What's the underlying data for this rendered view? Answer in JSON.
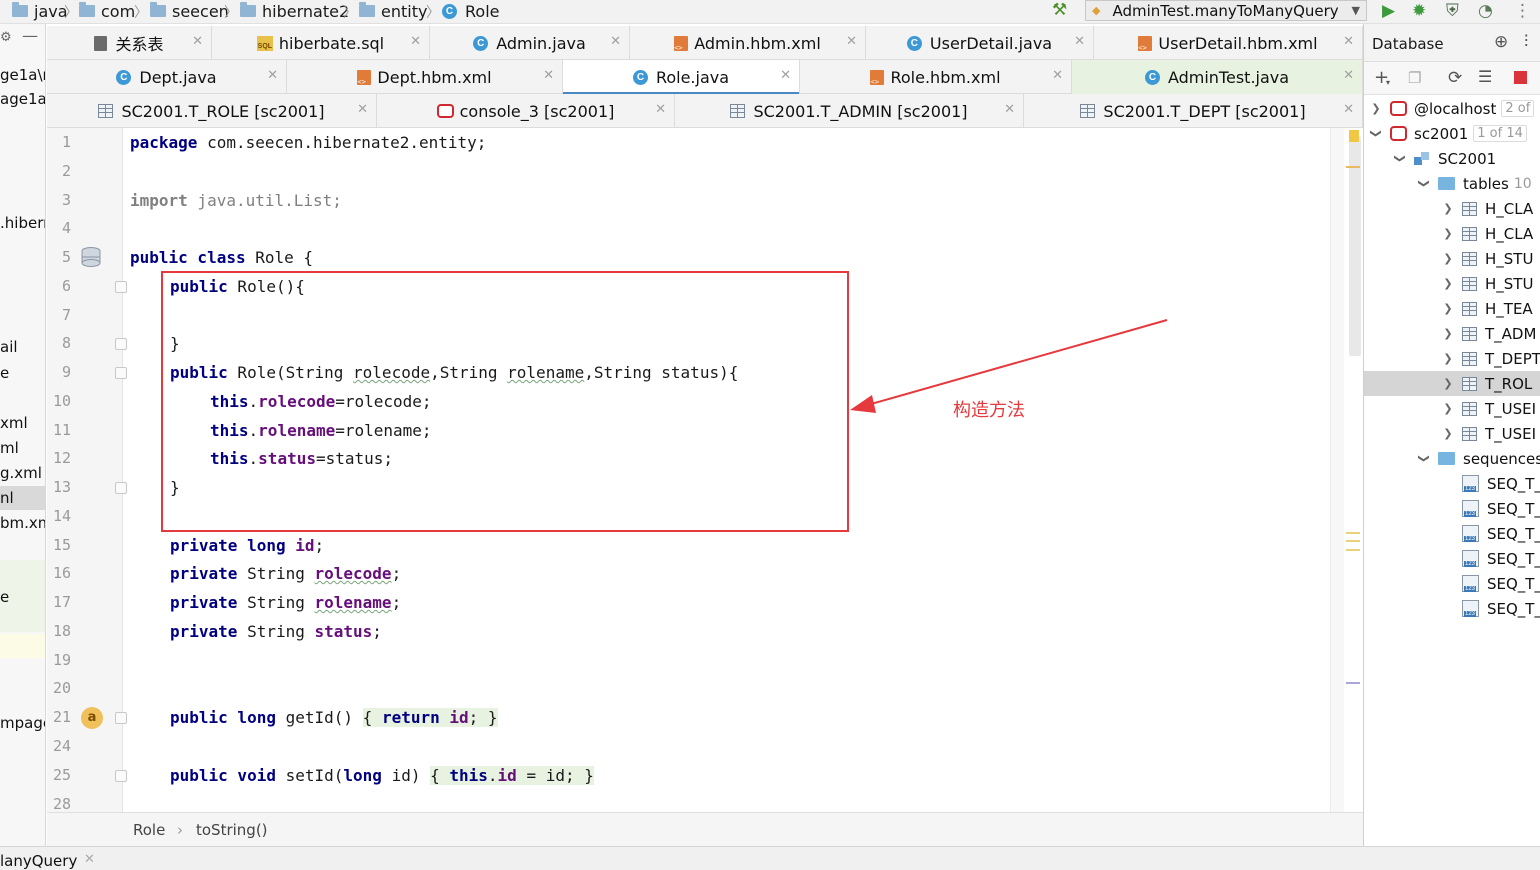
{
  "navbar": {
    "crumbs": [
      "java",
      "com",
      "seecen",
      "hibernate2",
      "entity",
      "Role"
    ],
    "run_config": "AdminTest.manyToManyQuery"
  },
  "left_panel": {
    "fragments": [
      "ge1a\\n",
      "age1a\\",
      ".hiberr",
      "ail",
      "e",
      "xml",
      "ml",
      "g.xml",
      "nl",
      "bm.xm",
      "e",
      "mpage"
    ]
  },
  "tabs": {
    "row1": [
      {
        "label": "关系表",
        "icon": "table-relation-icon"
      },
      {
        "label": "hiberbate.sql",
        "icon": "sql-file-icon"
      },
      {
        "label": "Admin.java",
        "icon": "java-class-icon"
      },
      {
        "label": "Admin.hbm.xml",
        "icon": "xml-file-icon"
      },
      {
        "label": "UserDetail.java",
        "icon": "java-class-icon"
      },
      {
        "label": "UserDetail.hbm.xml",
        "icon": "xml-file-icon"
      }
    ],
    "row2": [
      {
        "label": "Dept.java",
        "icon": "java-class-icon"
      },
      {
        "label": "Dept.hbm.xml",
        "icon": "xml-file-icon"
      },
      {
        "label": "Role.java",
        "icon": "java-class-icon",
        "active": true
      },
      {
        "label": "Role.hbm.xml",
        "icon": "xml-file-icon"
      },
      {
        "label": "AdminTest.java",
        "icon": "java-test-class-icon"
      }
    ],
    "row3": [
      {
        "label": "SC2001.T_ROLE [sc2001]",
        "icon": "table-icon"
      },
      {
        "label": "console_3 [sc2001]",
        "icon": "console-icon"
      },
      {
        "label": "SC2001.T_ADMIN [sc2001]",
        "icon": "table-icon"
      },
      {
        "label": "SC2001.T_DEPT [sc2001]",
        "icon": "table-icon"
      }
    ]
  },
  "editor": {
    "line_numbers": [
      "1",
      "2",
      "3",
      "4",
      "5",
      "6",
      "7",
      "8",
      "9",
      "10",
      "11",
      "12",
      "13",
      "14",
      "15",
      "16",
      "17",
      "18",
      "19",
      "20",
      "21",
      "24",
      "25",
      "28"
    ],
    "code": {
      "l1_kw": "package",
      "l1_rest": " com.seecen.hibernate2.entity;",
      "l3_kw": "import",
      "l3_rest": " java.util.List;",
      "l5_kw": "public class",
      "l5_rest": " Role {",
      "l6_kw": "public",
      "l6_rest": " Role(){",
      "l8": "}",
      "l9_kw": "public",
      "l9_a": " Role(String ",
      "l9_p1": "rolecode",
      "l9_b": ",String ",
      "l9_p2": "rolename",
      "l9_c": ",String status){",
      "l10_this": "this",
      "l10_dot": ".",
      "l10_fld": "rolecode",
      "l10_rest": "=rolecode;",
      "l11_this": "this",
      "l11_dot": ".",
      "l11_fld": "rolename",
      "l11_rest": "=rolename;",
      "l12_this": "this",
      "l12_dot": ".",
      "l12_fld": "status",
      "l12_rest": "=status;",
      "l13": "}",
      "l15_kw": "private long",
      "l15_sp": " ",
      "l15_fld": "id",
      "l15_semi": ";",
      "l16_kw": "private",
      "l16_type": " String ",
      "l16_fld": "rolecode",
      "l16_semi": ";",
      "l17_kw": "private",
      "l17_type": " String ",
      "l17_fld": "rolename",
      "l17_semi": ";",
      "l18_kw": "private",
      "l18_type": " String ",
      "l18_fld": "status",
      "l18_semi": ";",
      "l21_kw": "public long",
      "l21_name": " getId() ",
      "l21_ob": "{ ",
      "l21_ret": "return",
      "l21_sp": " ",
      "l21_fld": "id",
      "l21_cb": "; }",
      "l25_kw": "public void",
      "l25_name": " setId(",
      "l25_kw2": "long",
      "l25_param": " id) ",
      "l25_ob": "{ ",
      "l25_this": "this",
      "l25_dot": ".",
      "l25_fld": "id",
      "l25_cb": " = id; }"
    },
    "annotation": "构造方法",
    "breadcrumb": [
      "Role",
      "toString()"
    ]
  },
  "bottom_run_tab": "lanyQuery",
  "database": {
    "title": "Database",
    "tree": [
      {
        "label": "@localhost",
        "badge": "2 of",
        "icon": "database-icon",
        "level": 0,
        "expanded": false
      },
      {
        "label": "sc2001",
        "badge": "1 of 14",
        "icon": "database-icon",
        "level": 0,
        "expanded": true
      },
      {
        "label": "SC2001",
        "icon": "schema-icon",
        "level": 1,
        "expanded": true
      },
      {
        "label": "tables",
        "count": "10",
        "icon": "folder-icon",
        "level": 2,
        "expanded": true
      },
      {
        "label": "H_CLA",
        "icon": "table-icon",
        "level": 3
      },
      {
        "label": "H_CLA",
        "icon": "table-icon",
        "level": 3
      },
      {
        "label": "H_STU",
        "icon": "table-icon",
        "level": 3
      },
      {
        "label": "H_STU",
        "icon": "table-icon",
        "level": 3
      },
      {
        "label": "H_TEA",
        "icon": "table-icon",
        "level": 3
      },
      {
        "label": "T_ADM",
        "icon": "table-icon",
        "level": 3
      },
      {
        "label": "T_DEPT",
        "icon": "table-icon",
        "level": 3
      },
      {
        "label": "T_ROL",
        "icon": "table-icon",
        "level": 3,
        "selected": true
      },
      {
        "label": "T_USEI",
        "icon": "table-icon",
        "level": 3
      },
      {
        "label": "T_USEI",
        "icon": "table-icon",
        "level": 3
      },
      {
        "label": "sequences",
        "icon": "folder-icon",
        "level": 2,
        "expanded": true
      },
      {
        "label": "SEQ_T_",
        "icon": "sequence-icon",
        "level": 3
      },
      {
        "label": "SEQ_T_",
        "icon": "sequence-icon",
        "level": 3
      },
      {
        "label": "SEQ_T_",
        "icon": "sequence-icon",
        "level": 3
      },
      {
        "label": "SEQ_T_",
        "icon": "sequence-icon",
        "level": 3
      },
      {
        "label": "SEQ_T_",
        "icon": "sequence-icon",
        "level": 3
      },
      {
        "label": "SEQ_T_",
        "icon": "sequence-icon",
        "level": 3
      }
    ]
  },
  "colors": {
    "keyword": "#000080",
    "field": "#660e7a",
    "annotation_red": "#e5393e",
    "active_tab_underline": "#4a88c7"
  }
}
